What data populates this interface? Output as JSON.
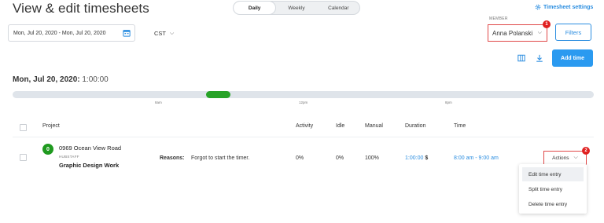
{
  "header": {
    "title": "View & edit timesheets",
    "view_tabs": [
      "Daily",
      "Weekly",
      "Calendar"
    ],
    "active_tab": "Daily",
    "settings_label": "Timesheet settings"
  },
  "filters_bar": {
    "date_range": "Mon, Jul 20, 2020 - Mon, Jul 20, 2020",
    "timezone": "CST",
    "member_label": "MEMBER",
    "member_value": "Anna Polanski",
    "member_badge": "1",
    "filters_label": "Filters",
    "add_time_label": "Add time"
  },
  "day": {
    "date": "Mon, Jul 20, 2020:",
    "total": "1:00:00"
  },
  "timeline": {
    "ticks": [
      "8am",
      "12pm",
      "8pm"
    ],
    "entry_start_fraction": 0.333,
    "entry_end_fraction": 0.375,
    "bar_color": "#27a327"
  },
  "table": {
    "columns": [
      "Project",
      "Activity",
      "Idle",
      "Manual",
      "Duration",
      "Time"
    ],
    "rows": [
      {
        "avatar_letter": "0",
        "project": "0969 Ocean View Road",
        "org": "HUBSTAFF",
        "task": "Graphic Design Work",
        "reasons_label": "Reasons:",
        "reason": "Forgot to start the timer.",
        "activity": "0%",
        "idle": "0%",
        "manual": "100%",
        "duration": "1:00:00",
        "duration_suffix": "$",
        "time": "8:00 am - 9:00 am",
        "actions_label": "Actions",
        "actions_badge": "2"
      }
    ]
  },
  "actions_menu": {
    "items": [
      "Edit time entry",
      "Split time entry",
      "Delete time entry"
    ],
    "hovered_index": 0
  },
  "colors": {
    "accent": "#2a8de0",
    "highlight": "#e04848",
    "badge": "#e02020",
    "avatar": "#1f9a1f"
  }
}
